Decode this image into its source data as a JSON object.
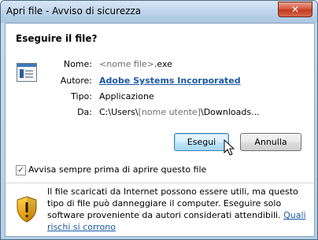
{
  "window": {
    "title": "Apri file - Avviso di sicurezza",
    "close_glyph": "✕"
  },
  "dialog": {
    "heading": "Eseguire il file?",
    "file_icon": "application-window-icon",
    "fields": {
      "name_label": "Nome:",
      "name_value_placeholder": "<nome file>",
      "name_value_ext": ".exe",
      "author_label": "Autore:",
      "author_value": "Adobe Systems Incorporated",
      "type_label": "Tipo:",
      "type_value": "Applicazione",
      "from_label": "Da:",
      "from_value_prefix": "C:\\Users\\",
      "from_value_placeholder": "[nome utente]",
      "from_value_suffix": "\\Downloads..."
    },
    "buttons": {
      "run": "Esegui",
      "cancel": "Annulla"
    },
    "checkbox": {
      "label": "Avvisa sempre prima di aprire questo file",
      "checked": true,
      "glyph": "✓"
    },
    "notice": {
      "text": "Il file scaricati da Internet possono essere utili, ma questo tipo di file può danneggiare il computer. Eseguire solo software proveniente da autori considerati attendibili.",
      "link": "Quali rischi si corrono",
      "icon": "warning-shield-icon"
    }
  },
  "colors": {
    "link": "#1c57a4",
    "titlebar": "#bcd3ea",
    "close_button": "#c23a20"
  }
}
